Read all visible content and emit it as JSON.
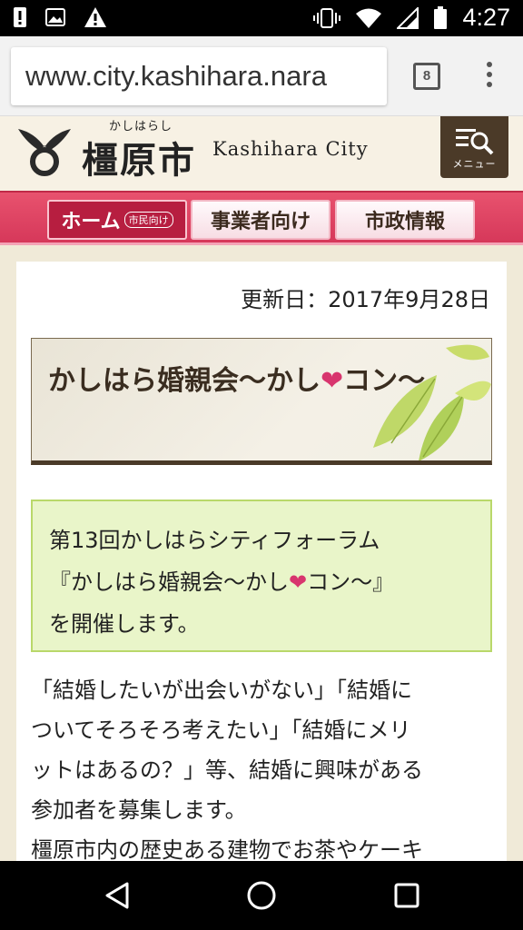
{
  "status_bar": {
    "time": "4:27",
    "icons": [
      "alert-exclamation-icon",
      "image-icon",
      "warning-icon",
      "vibrate-icon",
      "wifi-icon",
      "signal-icon",
      "battery-icon"
    ]
  },
  "browser": {
    "url": "www.city.kashihara.nara",
    "tab_count": "8"
  },
  "site": {
    "logo_ruby": "かしはらし",
    "logo_name": "橿原市",
    "logo_roman": "Kashihara City",
    "menu_label": "メニュー",
    "nav": {
      "home": "ホーム",
      "home_sub": "市民向け",
      "business": "事業者向け",
      "city": "市政情報"
    }
  },
  "page": {
    "updated": "更新日：2017年9月28日",
    "title_part1": "かしはら婚親会〜かし",
    "title_heart": "❤",
    "title_part2": "コン〜",
    "info_line1": "第13回かしはらシティフォーラム",
    "info_line2_a": "『かしはら婚親会〜かし",
    "info_heart": "❤",
    "info_line2_b": "コン〜』",
    "info_line3": "を開催します。",
    "body_line1": "「結婚したいが出会いがない」「結婚に",
    "body_line2": "ついてそろそろ考えたい」「結婚にメリ",
    "body_line3": "ットはあるの？」等、結婚に興味がある",
    "body_line4": "参加者を募集します。",
    "body_line5": "橿原市内の歴史ある建物でお茶やケーキ"
  },
  "colors": {
    "nav_pink": "#e8526e",
    "home_tab": "#b71e40",
    "heart": "#d8356e",
    "info_bg": "#e9f5c9",
    "menu_bg": "#4b3a28"
  }
}
